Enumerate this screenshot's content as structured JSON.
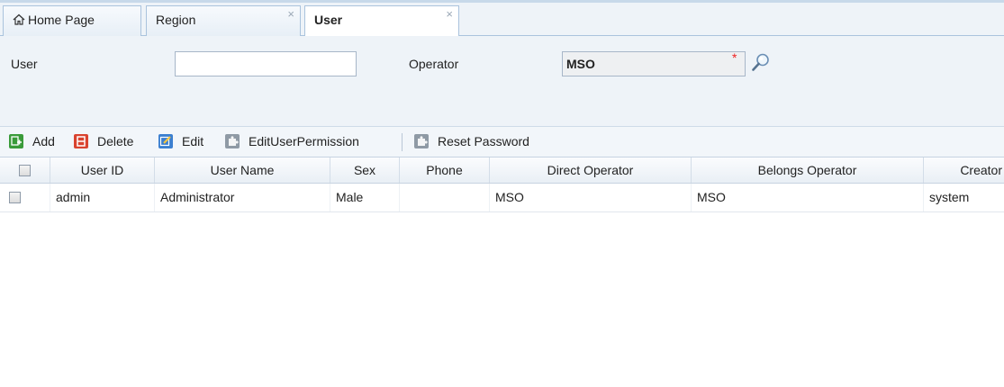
{
  "tabs": [
    {
      "label": "Home Page",
      "icon": "home-icon",
      "closable": false,
      "active": false
    },
    {
      "label": "Region",
      "closable": true,
      "active": false
    },
    {
      "label": "User",
      "closable": true,
      "active": true
    }
  ],
  "tab_close_glyph": "×",
  "filter": {
    "user_label": "User",
    "user_value": "",
    "operator_label": "Operator",
    "operator_value": "MSO",
    "required_mark": "*",
    "lookup_icon": "magnifier-icon"
  },
  "toolbar": {
    "add_label": "Add",
    "delete_label": "Delete",
    "edit_label": "Edit",
    "edit_permission_label": "EditUserPermission",
    "reset_password_label": "Reset Password"
  },
  "grid": {
    "columns": [
      "User ID",
      "User Name",
      "Sex",
      "Phone",
      "Direct Operator",
      "Belongs Operator",
      "Creator"
    ],
    "rows": [
      [
        "admin",
        "Administrator",
        "Male",
        "",
        "MSO",
        "MSO",
        "system"
      ]
    ]
  },
  "colors": {
    "panel_bg": "#eef3f8",
    "add_icon": "#3a9b3a",
    "delete_icon": "#d9432f",
    "edit_icon": "#3b7fd0",
    "gray_icon": "#8f9aa5",
    "required": "#e22222"
  }
}
